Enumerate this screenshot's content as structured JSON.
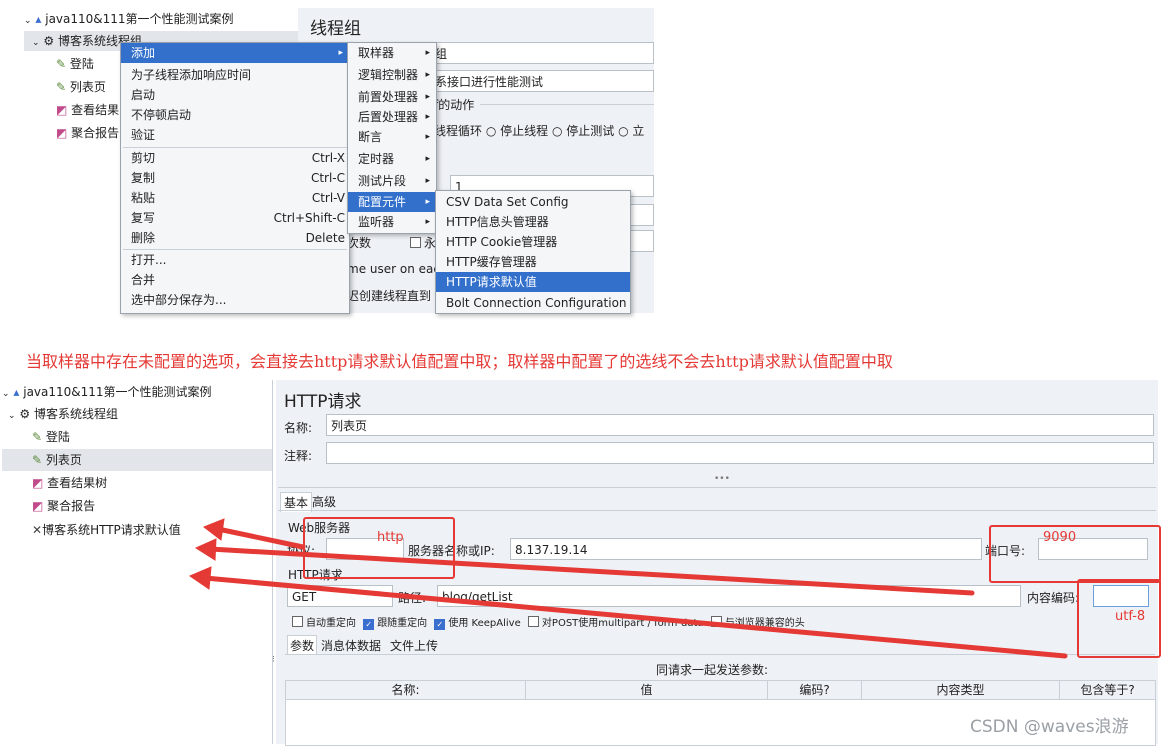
{
  "top": {
    "tree": {
      "root": "java110&111第一个性能测试案例",
      "group": "博客系统线程组",
      "children": [
        "登陆",
        "列表页",
        "查看结果",
        "聚合报告"
      ]
    },
    "panel_title": "线程组",
    "bg_fragments": {
      "name_tail": "组",
      "comment_tail": "系接口进行性能测试",
      "action_label": "f的动作",
      "actions": [
        "线程循环",
        "停止线程",
        "停止测试",
        "立"
      ],
      "loop_value": "1",
      "loop_label": "次数",
      "same_user": "me user on each",
      "delay": "迟创建线程直到"
    },
    "menu1": {
      "items": [
        {
          "label": "添加"
        },
        {
          "label": "为子线程添加响应时间"
        },
        {
          "label": "启动"
        },
        {
          "label": "不停顿启动"
        },
        {
          "label": "验证"
        },
        {
          "label": "剪切",
          "shortcut": "Ctrl-X"
        },
        {
          "label": "复制",
          "shortcut": "Ctrl-C"
        },
        {
          "label": "粘贴",
          "shortcut": "Ctrl-V"
        },
        {
          "label": "复写",
          "shortcut": "Ctrl+Shift-C"
        },
        {
          "label": "删除",
          "shortcut": "Delete"
        },
        {
          "label": "打开..."
        },
        {
          "label": "合并"
        },
        {
          "label": "选中部分保存为..."
        }
      ]
    },
    "menu2": {
      "items": [
        "取样器",
        "逻辑控制器",
        "前置处理器",
        "后置处理器",
        "断言",
        "定时器",
        "测试片段",
        "配置元件",
        "监听器"
      ]
    },
    "menu3": {
      "items": [
        "CSV Data Set Config",
        "HTTP信息头管理器",
        "HTTP Cookie管理器",
        "HTTP缓存管理器",
        "HTTP请求默认值",
        "Bolt Connection Configuration"
      ]
    }
  },
  "caption": "当取样器中存在未配置的选项，会直接去http请求默认值配置中取；取样器中配置了的选线不会去http请求默认值配置中取",
  "bottom": {
    "tree": {
      "root": "java110&111第一个性能测试案例",
      "group": "博客系统线程组",
      "children": [
        "登陆",
        "列表页",
        "查看结果树",
        "聚合报告",
        "博客系统HTTP请求默认值"
      ]
    },
    "panel_title": "HTTP请求",
    "name_label": "名称:",
    "name_value": "列表页",
    "comment_label": "注释:",
    "tabs": [
      "基本",
      "高级"
    ],
    "web_server_label": "Web服务器",
    "protocol_label": "协议:",
    "server_label": "服务器名称或IP:",
    "server_value": "8.137.19.14",
    "port_label": "端口号:",
    "http_request_label": "HTTP请求",
    "method_value": "GET",
    "path_label": "路径:",
    "path_value": "blog/getList",
    "encoding_label": "内容编码:",
    "options": [
      {
        "label": "自动重定向",
        "checked": false
      },
      {
        "label": "跟随重定向",
        "checked": true
      },
      {
        "label": "使用 KeepAlive",
        "checked": true
      },
      {
        "label": "对POST使用multipart / form-data",
        "checked": false
      },
      {
        "label": "与浏览器兼容的头",
        "checked": false
      }
    ],
    "subtabs": [
      "参数",
      "消息体数据",
      "文件上传"
    ],
    "params_caption": "同请求一起发送参数:",
    "columns": [
      "名称:",
      "值",
      "编码?",
      "内容类型",
      "包含等于?"
    ]
  },
  "annotations": {
    "http": "http",
    "port": "9090",
    "encoding": "utf-8"
  },
  "watermark": "CSDN @waves浪游",
  "colors": {
    "selection": "#3370cc",
    "annotation": "#e53935",
    "panel": "#eef1f5"
  }
}
